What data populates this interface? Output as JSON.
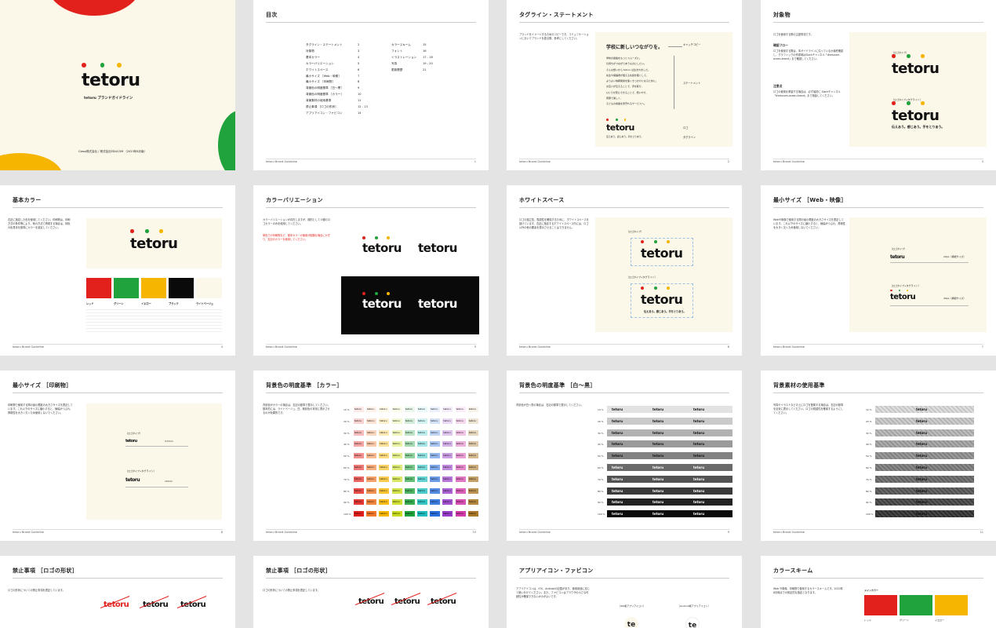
{
  "footer": "tetoru Brand Guideline",
  "colors": {
    "red": "#e2211c",
    "green": "#20a23c",
    "yellow": "#f6b500",
    "black": "#0a0a0a",
    "cream": "#fbf7e9"
  },
  "logo_text": "tetoru",
  "cover": {
    "subtitle": "tetoru ブランドガイドライン",
    "company": "Classi株式会社 / 株式会社EDUCOM （2023年8月版）"
  },
  "toc": {
    "title": "目次",
    "page": "1",
    "col1": [
      {
        "label": "タグライン・ステートメント",
        "page": "2"
      },
      {
        "label": "対象物",
        "page": "3"
      },
      {
        "label": "基本カラー",
        "page": "4"
      },
      {
        "label": "カラーバリエーション",
        "page": "5"
      },
      {
        "label": "ホワイトスペース",
        "page": "6"
      },
      {
        "label": "最小サイズ ［Web・映像］",
        "page": "7"
      },
      {
        "label": "最小サイズ ［印刷物］",
        "page": "8"
      },
      {
        "label": "背景色の明度基準 ［白〜黒］",
        "page": "9"
      },
      {
        "label": "背景色の明度基準 ［カラー］",
        "page": "10"
      },
      {
        "label": "背景素材の使用基準",
        "page": "11"
      },
      {
        "label": "禁止事項 ［ロゴの形状］",
        "page": "12 - 13"
      },
      {
        "label": "アプリアイコン・ファビコン",
        "page": "14"
      }
    ],
    "col2": [
      {
        "label": "カラースキーム",
        "page": "15"
      },
      {
        "label": "フォント",
        "page": "16"
      },
      {
        "label": "イラストレーション",
        "page": "17 - 18"
      },
      {
        "label": "写真",
        "page": "19 - 20"
      },
      {
        "label": "更新履歴",
        "page": "21"
      }
    ]
  },
  "tagline": {
    "title": "タグライン・ステートメント",
    "page": "2",
    "desc": "ブランドをイメージするためのコピーです。コミュニケーションにおいてブランドを語る際、参考にしてください。",
    "catch": "学校に新しいつながりを。",
    "catch_label": "キャッチコピー",
    "statement": [
      "学校の連絡をもっとスムーズに。",
      "気持ちがつながりあうものにしたい。",
      "そんな想いから tetoru は生まれました。",
      "先生や保護者が抱える負担を軽くして、",
      "よりよい信頼関係を築くきっかけになるために。",
      "お互いが伝えることで、手を取り、",
      "ひとりが安心できることで、想いやり、",
      "笑顔で楽しく、",
      "子どもの成長を見守れるサービスへ。"
    ],
    "statement_label": "ステートメント",
    "logo_label": "ロゴ",
    "tag_label": "タグライン",
    "tagline_text": "伝えあう。感じあう。手をとりあう。"
  },
  "target": {
    "title": "対象物",
    "page": "3",
    "desc": "ロゴを使用する際の主題事項です。",
    "flow_title": "確認フロー",
    "flow_text": "ロゴを使用する際は、本ガイドラインに沿っているか最終確認し、グラフィックの作成時はSlackチャンネル「#educom-ocean-brand」まで確認してください。",
    "note_title": "注意点",
    "note_text": "ロゴの使用を希望する場合は、必ず最初に Slackチャンネル「#educom-ocean-brand」まで相談してください。",
    "label1": "［ロゴタイプ］",
    "label2": "［ロゴタイプ+タグライン］",
    "tagline_text": "伝えあう。感じあう。手をとりあう。"
  },
  "basic_color": {
    "title": "基本カラー",
    "page": "4",
    "desc": "右記に指定した色を使用してください。印刷物は、印刷方式の条件等により、他の方法で再現する場合は、特色の色見本を基準にカラーを設定してください。",
    "names": [
      "レッド",
      "グリーン",
      "イエロー",
      "ブラック",
      "ライトベージュ"
    ]
  },
  "color_var": {
    "title": "カラーバリエーション",
    "page": "5",
    "desc": "カラーバリエーションが存在しますが、原則として４種のロゴカラーのみを使用してください。",
    "note": "単色での印刷物など、基本カラーの使用が困難な場合にかぎり、右記のカラーを使用してください。"
  },
  "white_space": {
    "title": "ホワイトスペース",
    "page": "6",
    "desc": "ロゴの独立性、視認性を確保するために、ホワイトスペースを設けています。右記に指定するホワイトスペース内には、ロゴ以外の他の要素を表示させることはできません。",
    "label1": "［ロゴタイプ］",
    "label2": "［ロゴタイプ+タグライン］",
    "tagline_text": "伝えあう。感じあう。手をとりあう。"
  },
  "min_web": {
    "title": "最小サイズ ［Web・映像］",
    "page": "7",
    "desc": "Webや映像で使用する際の最小限度の大きさサイズを表記しています。これ以下のサイズに縮小すると、線幅がつぶれ、再現性を大きく欠くため使用しないでください。",
    "label1": "［ロゴタイプ］",
    "size1": "20px（横幅サイズ）",
    "label2": "［ロゴタイプ+タグライン］",
    "size2": "40px（横幅サイズ）"
  },
  "min_print": {
    "title": "最小サイズ ［印刷物］",
    "page": "8",
    "desc": "印刷物で使用する際の最小限度の大きさサイズを表記しています。これ以下のサイズに縮小すると、線幅がつぶれ、再現性を大きく欠くため使用しないでください。",
    "label1": "［ロゴタイプ］",
    "size1": "4.5mm",
    "label2": "［ロゴタイプ+タグライン］",
    "size2": "10mm"
  },
  "bg_color": {
    "title": "背景色の明度基準 ［カラー］",
    "page": "10",
    "desc": "背景色がカラーの場合は、右記の基準で表示してください。基本的には、ライトベージュ、白、無彩色の背景に表示させるのが効果的です。",
    "pcts": [
      "10 %",
      "20 %",
      "30 %",
      "40 %",
      "50 %",
      "60 %",
      "70 %",
      "80 %",
      "90 %",
      "100 %"
    ]
  },
  "bg_mono": {
    "title": "背景色の明度基準 ［白〜黒］",
    "page": "9",
    "desc": "背景色が白〜黒の場合は、右記の基準で表示してください。",
    "pcts": [
      "10 %",
      "20 %",
      "30 %",
      "40 %",
      "50 %",
      "60 %",
      "70 %",
      "80 %",
      "90 %",
      "100 %"
    ]
  },
  "bg_material": {
    "title": "背景素材の使用基準",
    "page": "11",
    "desc": "写真やイラストなどの上にロゴを配置する場合は、右記の基準を目安に表示してください。ロゴの視認性を確保するようにしてください。",
    "pcts": [
      "10 %",
      "20 %",
      "30 %",
      "40 %",
      "50 %",
      "60 %",
      "70 %",
      "80 %",
      "90 %",
      "100 %"
    ]
  },
  "prohibit1": {
    "title": "禁止事項 ［ロゴの形状］",
    "desc": "ロゴの形状についての禁止事項を表記しています。"
  },
  "prohibit2": {
    "title": "禁止事項 ［ロゴの形状］",
    "desc": "ロゴの形状についての禁止事項を表記しています。"
  },
  "app_icon": {
    "title": "アプリアイコン・ファビコン",
    "desc": "アプリアイコンは、iOS、Androidの記載があり、使用用途に応じて使い分けてください。また、ファビコンはブラウザの小さな可読性が確保できない大小がよいです。",
    "label1": "［iOS版アプリアイコン］",
    "label2": "［Android版アプリアイコン］"
  },
  "color_scheme": {
    "title": "カラースキーム",
    "desc": "Web や映像、印刷物で使用するカラースキームです。2023年8月時点での暫定的な指定となります。",
    "main_label": "メインカラー",
    "names": [
      "レッド",
      "グリーン",
      "イエロー"
    ]
  }
}
